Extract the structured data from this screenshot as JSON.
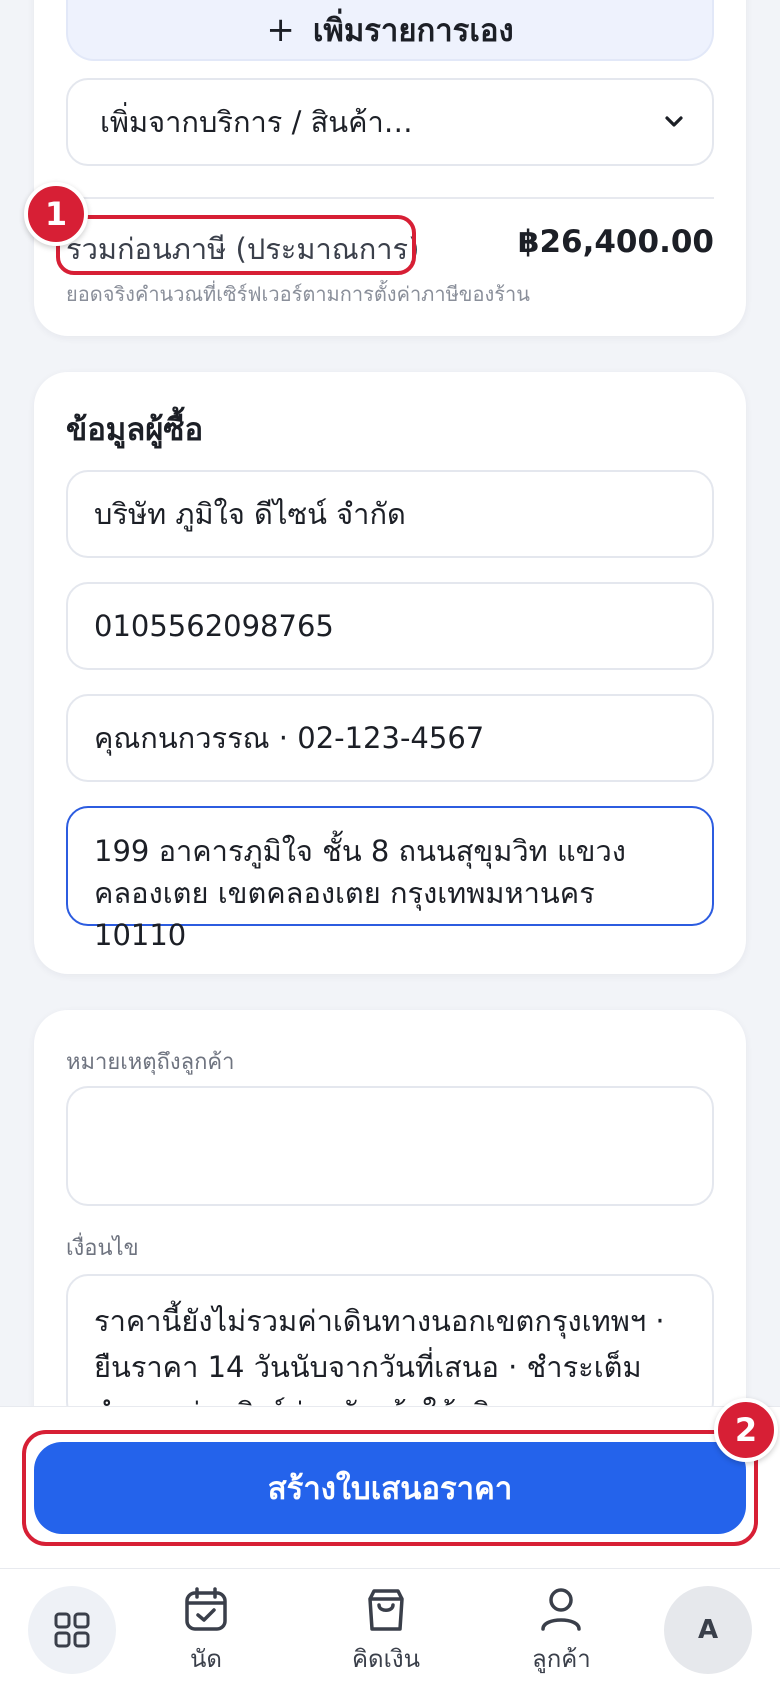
{
  "items": {
    "add_manual_label": "เพิ่มรายการเอง",
    "add_from_select": "เพิ่มจากบริการ / สินค้า…",
    "subtotal_label": "รวมก่อนภาษี (ประมาณการ)",
    "subtotal_value": "฿26,400.00",
    "subtotal_note": "ยอดจริงคำนวณที่เซิร์ฟเวอร์ตามการตั้งค่าภาษีของร้าน"
  },
  "buyer": {
    "title": "ข้อมูลผู้ซื้อ",
    "company": "บริษัท ภูมิใจ ดีไซน์ จำกัด",
    "tax_id": "0105562098765",
    "contact": "คุณกนกวรรณ · 02-123-4567",
    "address": "199 อาคารภูมิใจ ชั้น 8 ถนนสุขุมวิท แขวงคลองเตย เขตคลองเตย กรุงเทพมหานคร 10110"
  },
  "notes": {
    "note_label": "หมายเหตุถึงลูกค้า",
    "note_value": "",
    "terms_label": "เงื่อนไข",
    "terms_value": "ราคานี้ยังไม่รวมค่าเดินทางนอกเขตกรุงเทพฯ · ยืนราคา 14 วันนับจากวันที่เสนอ · ชำระเต็มจำนวนผ่านลิงก์ก่อนวันเข้าให้บริการ"
  },
  "submit_label": "สร้างใบเสนอราคา",
  "annotations": {
    "badge_1": "1",
    "badge_2": "2"
  },
  "tabs": {
    "appointments": "นัด",
    "billing": "คิดเงิน",
    "customers": "ลูกค้า",
    "avatar_initial": "A"
  },
  "colors": {
    "accent": "#2463eb",
    "highlight": "#d71f35",
    "background": "#f2f4f8"
  }
}
